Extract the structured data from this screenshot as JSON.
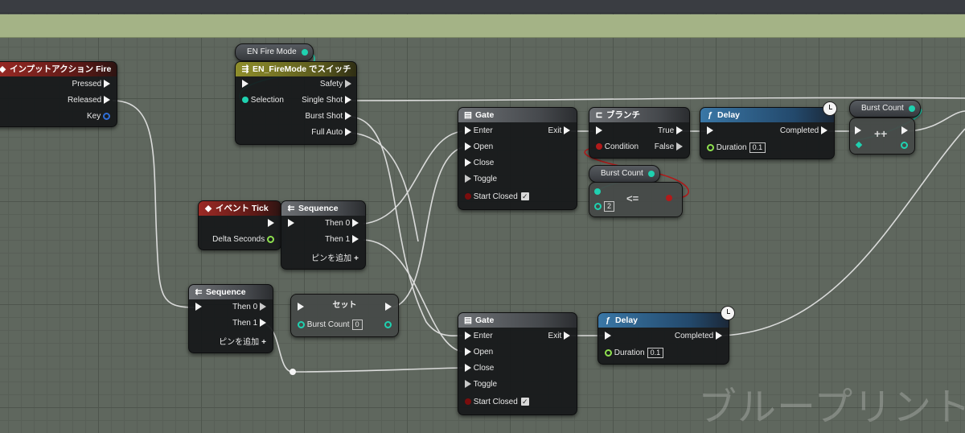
{
  "watermark": "ブループリント",
  "input_action": {
    "title": "インプットアクション Fire",
    "pins": {
      "pressed": "Pressed",
      "released": "Released",
      "key": "Key"
    }
  },
  "fire_mode_var": {
    "label": "EN Fire Mode"
  },
  "switch_node": {
    "title": "EN_FireMode でスイッチ",
    "selection": "Selection",
    "safety": "Safety",
    "single": "Single Shot",
    "burst": "Burst Shot",
    "full": "Full Auto"
  },
  "event_tick": {
    "title": "イベント Tick",
    "delta": "Delta Seconds"
  },
  "sequence_1": {
    "title": "Sequence",
    "then0": "Then 0",
    "then1": "Then 1",
    "add_pin": "ピンを追加"
  },
  "sequence_2": {
    "title": "Sequence",
    "then0": "Then 0",
    "then1": "Then 1",
    "add_pin": "ピンを追加"
  },
  "set_node": {
    "title": "セット",
    "var_label": "Burst Count",
    "value": "0"
  },
  "gate_1": {
    "title": "Gate",
    "enter": "Enter",
    "exit": "Exit",
    "open": "Open",
    "close": "Close",
    "toggle": "Toggle",
    "start_closed": "Start Closed"
  },
  "gate_2": {
    "title": "Gate",
    "enter": "Enter",
    "exit": "Exit",
    "open": "Open",
    "close": "Close",
    "toggle": "Toggle",
    "start_closed": "Start Closed"
  },
  "branch": {
    "title": "ブランチ",
    "condition": "Condition",
    "true_pin": "True",
    "false_pin": "False"
  },
  "burst_count_var_1": {
    "label": "Burst Count"
  },
  "compare_node": {
    "op": "<=",
    "value": "2"
  },
  "delay_1": {
    "title": "Delay",
    "completed": "Completed",
    "duration": "Duration",
    "value": "0.1"
  },
  "delay_2": {
    "title": "Delay",
    "completed": "Completed",
    "duration": "Duration",
    "value": "0.1"
  },
  "burst_count_var_2": {
    "label": "Burst Count"
  },
  "increment_node": {
    "op": "++"
  },
  "colors": {
    "exec": "#f4f4f4",
    "int_pin": "#1fd1b0",
    "float_pin": "#8fe14f",
    "bool_pin": "#b11a1a",
    "comment": "#a4b386"
  }
}
